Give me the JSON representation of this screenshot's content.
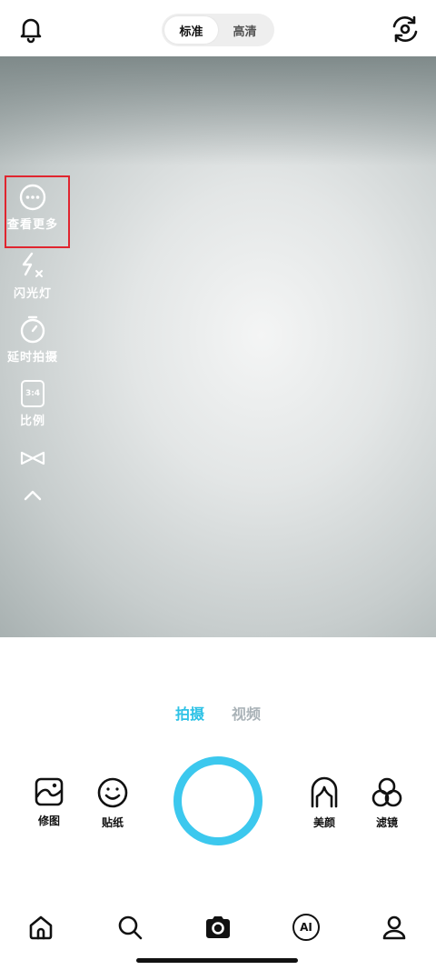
{
  "header": {
    "quality_options": [
      "标准",
      "高清"
    ],
    "selected_quality": "标准",
    "icons": {
      "left": "bell-icon",
      "right": "camera-flip-icon"
    }
  },
  "side_tools": [
    {
      "label": "查看更多",
      "icon": "more-circle-icon",
      "highlighted": true
    },
    {
      "label": "闪光灯",
      "icon": "flash-off-icon"
    },
    {
      "label": "延时拍摄",
      "icon": "timer-icon"
    },
    {
      "label": "比例",
      "icon": "ratio-icon",
      "badge": "3:4"
    },
    {
      "icon": "infinity-icon"
    },
    {
      "icon": "chevron-up-icon"
    }
  ],
  "modes": [
    "拍摄",
    "视频"
  ],
  "active_mode": "拍摄",
  "bottom_tools": [
    {
      "label": "修图",
      "icon": "image-edit-icon"
    },
    {
      "label": "贴纸",
      "icon": "smile-sticker-icon"
    },
    {
      "label": "美颜",
      "icon": "beauty-face-icon"
    },
    {
      "label": "滤镜",
      "icon": "filter-circles-icon"
    }
  ],
  "nav": [
    "home-icon",
    "search-icon",
    "camera-icon",
    "ai-icon",
    "profile-icon"
  ],
  "ai_label": "AI",
  "colors": {
    "accent": "#3cc8ee",
    "highlight_box": "#e0252f"
  }
}
